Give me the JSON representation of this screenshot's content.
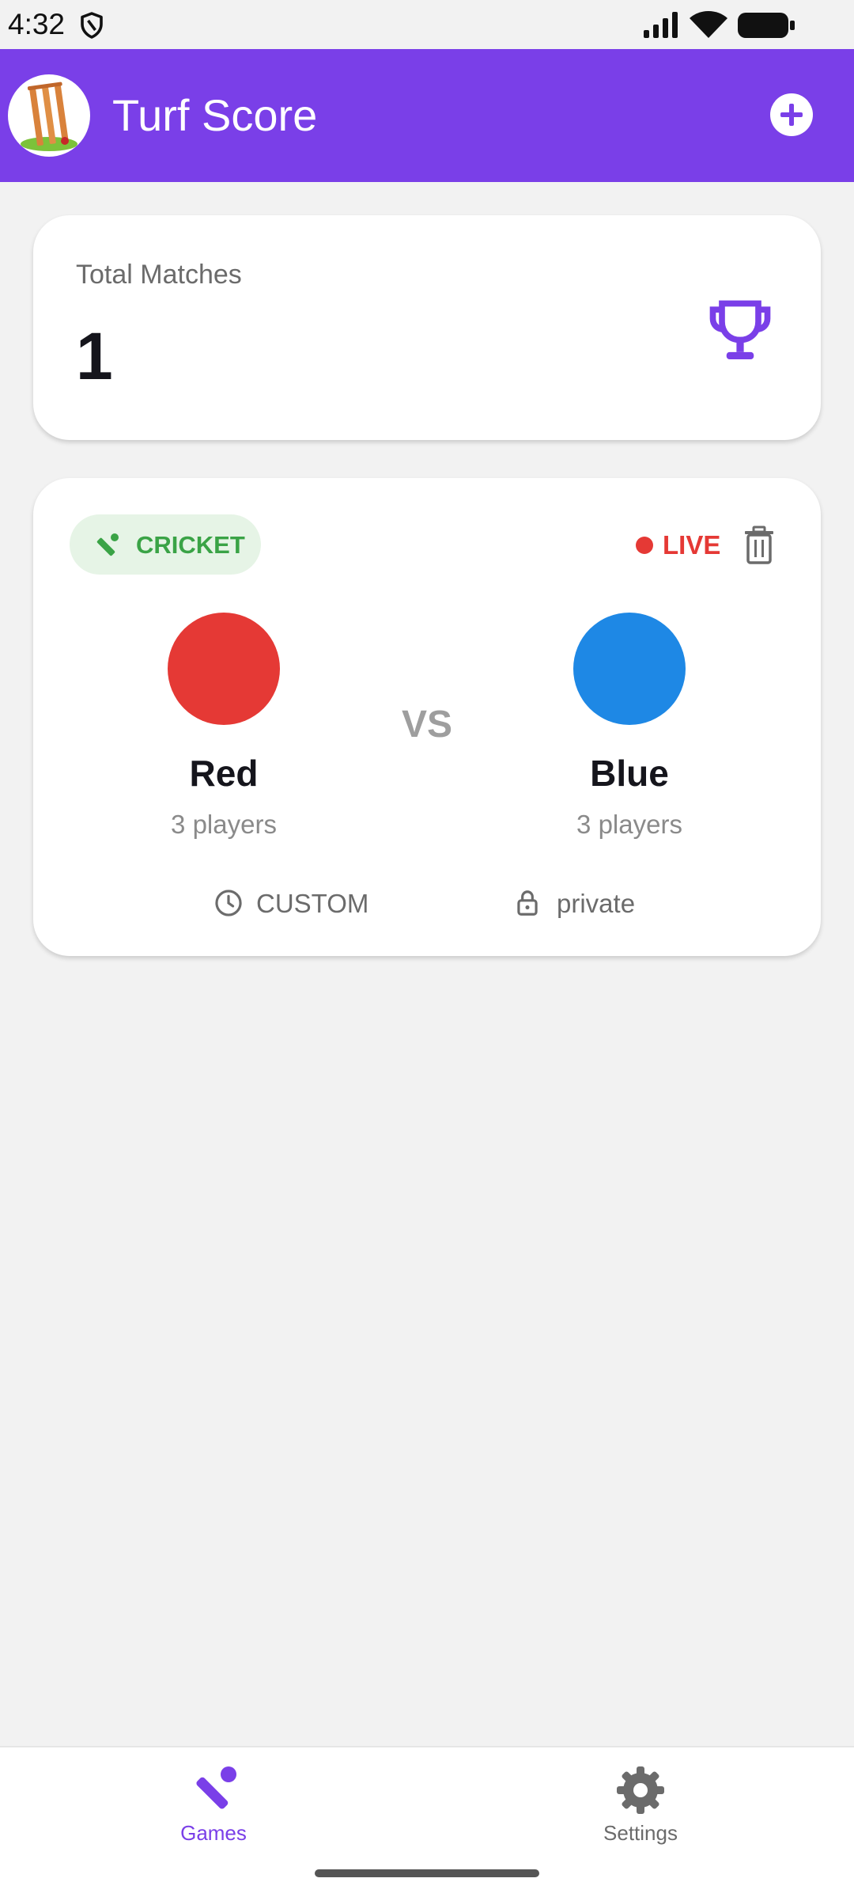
{
  "status_bar": {
    "time": "4:32",
    "icons": [
      "shield-icon",
      "signal-icon",
      "wifi-icon",
      "battery-icon"
    ]
  },
  "app_bar": {
    "title": "Turf Score",
    "logo_icon": "cricket-stumps-logo",
    "action_icon": "add-circle-icon",
    "color": "#7a3fe8"
  },
  "summary": {
    "label": "Total Matches",
    "value": "1",
    "icon": "trophy-icon"
  },
  "match": {
    "sport": "CRICKET",
    "sport_icon": "cricket-bat-icon",
    "status": "LIVE",
    "status_color": "#e53935",
    "delete_icon": "trash-icon",
    "vs": "VS",
    "team_a": {
      "name": "Red",
      "players": "3 players",
      "color": "#e53935"
    },
    "team_b": {
      "name": "Blue",
      "players": "3 players",
      "color": "#1e88e5"
    },
    "format": "CUSTOM",
    "format_icon": "clock-icon",
    "visibility": "private",
    "visibility_icon": "lock-icon"
  },
  "bottom_nav": {
    "items": [
      {
        "label": "Games",
        "icon": "cricket-bat-icon",
        "active": true
      },
      {
        "label": "Settings",
        "icon": "gear-icon",
        "active": false
      }
    ],
    "active_color": "#7a3fe8",
    "inactive_color": "#6b6b6b"
  }
}
